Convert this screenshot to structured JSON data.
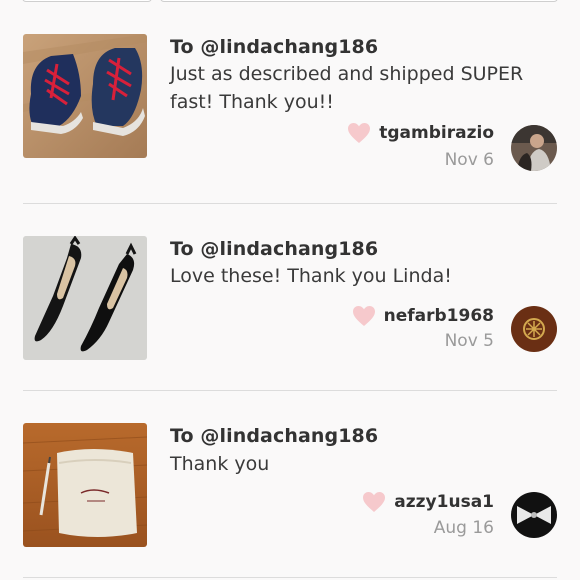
{
  "reviews": [
    {
      "to": "To @lindachang186",
      "comment": "Just as described and shipped SUPER fast! Thank you!!",
      "username": "tgambirazio",
      "date": "Nov 6",
      "thumbnail": "sneaker-photo",
      "avatar": "user-photo"
    },
    {
      "to": "To @lindachang186",
      "comment": "Love these! Thank you Linda!",
      "username": "nefarb1968",
      "date": "Nov 5",
      "thumbnail": "pumps-photo",
      "avatar": "brand-logo-avatar"
    },
    {
      "to": "To @lindachang186",
      "comment": "Thank you",
      "username": "azzy1usa1",
      "date": "Aug 16",
      "thumbnail": "dust-bag-photo",
      "avatar": "bow-avatar"
    }
  ],
  "colors": {
    "background": "#faf9f9",
    "heart": "#f6c9cc",
    "muted_text": "#9a9a9a",
    "divider": "#dcdcdc"
  },
  "icons": {
    "like": "heart-icon"
  }
}
